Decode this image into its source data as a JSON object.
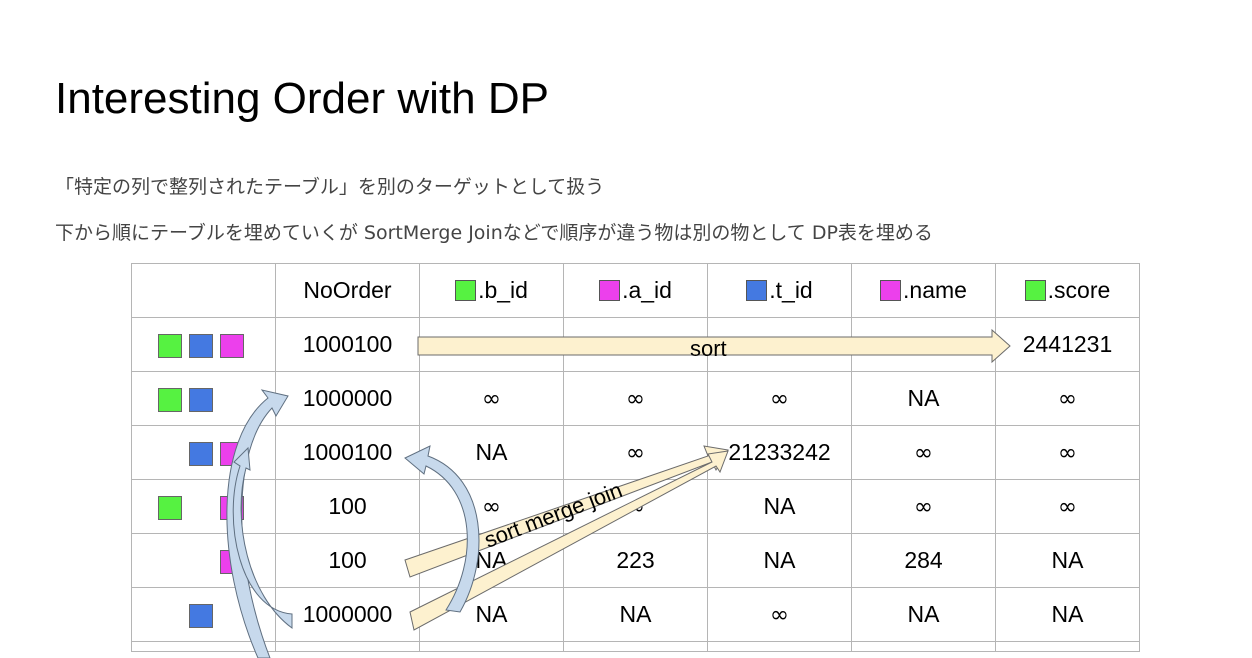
{
  "title": "Interesting Order with DP",
  "lines": [
    "「特定の列で整列されたテーブル」を別のターゲットとして扱う",
    "下から順にテーブルを埋めていくが SortMerge Joinなどで順序が違う物は別の物として DP表を埋める"
  ],
  "colors": {
    "green": "#56f241",
    "magenta": "#ec40ec",
    "blue": "#4479e1",
    "sort_arrow": "#fdf1cf",
    "back_arrow": "#c7d9ec"
  },
  "table": {
    "headers": [
      {
        "label": "",
        "color": ""
      },
      {
        "label": "NoOrder",
        "color": ""
      },
      {
        "label": ".b_id",
        "color": "green"
      },
      {
        "label": ".a_id",
        "color": "magenta"
      },
      {
        "label": ".t_id",
        "color": "blue"
      },
      {
        "label": ".name",
        "color": "magenta"
      },
      {
        "label": ".score",
        "color": "green"
      }
    ],
    "rows": [
      {
        "key": [
          "green",
          "blue",
          "magenta"
        ],
        "cells": [
          "1000100",
          "",
          "",
          "",
          "",
          "2441231"
        ]
      },
      {
        "key": [
          "green",
          "blue",
          ""
        ],
        "cells": [
          "1000000",
          "∞",
          "∞",
          "∞",
          "NA",
          "∞"
        ]
      },
      {
        "key": [
          "",
          "blue",
          "magenta"
        ],
        "cells": [
          "1000100",
          "NA",
          "∞",
          "21233242",
          "∞",
          "∞"
        ]
      },
      {
        "key": [
          "green",
          "",
          "magenta"
        ],
        "cells": [
          "100",
          "∞",
          "∞",
          "NA",
          "∞",
          "∞"
        ]
      },
      {
        "key": [
          "",
          "",
          "magenta"
        ],
        "cells": [
          "100",
          "NA",
          "223",
          "NA",
          "284",
          "NA"
        ]
      },
      {
        "key": [
          "",
          "blue",
          ""
        ],
        "cells": [
          "1000000",
          "NA",
          "NA",
          "∞",
          "NA",
          "NA"
        ]
      }
    ]
  },
  "annotations": {
    "sort": "sort",
    "sort_merge_join": "sort merge join"
  }
}
